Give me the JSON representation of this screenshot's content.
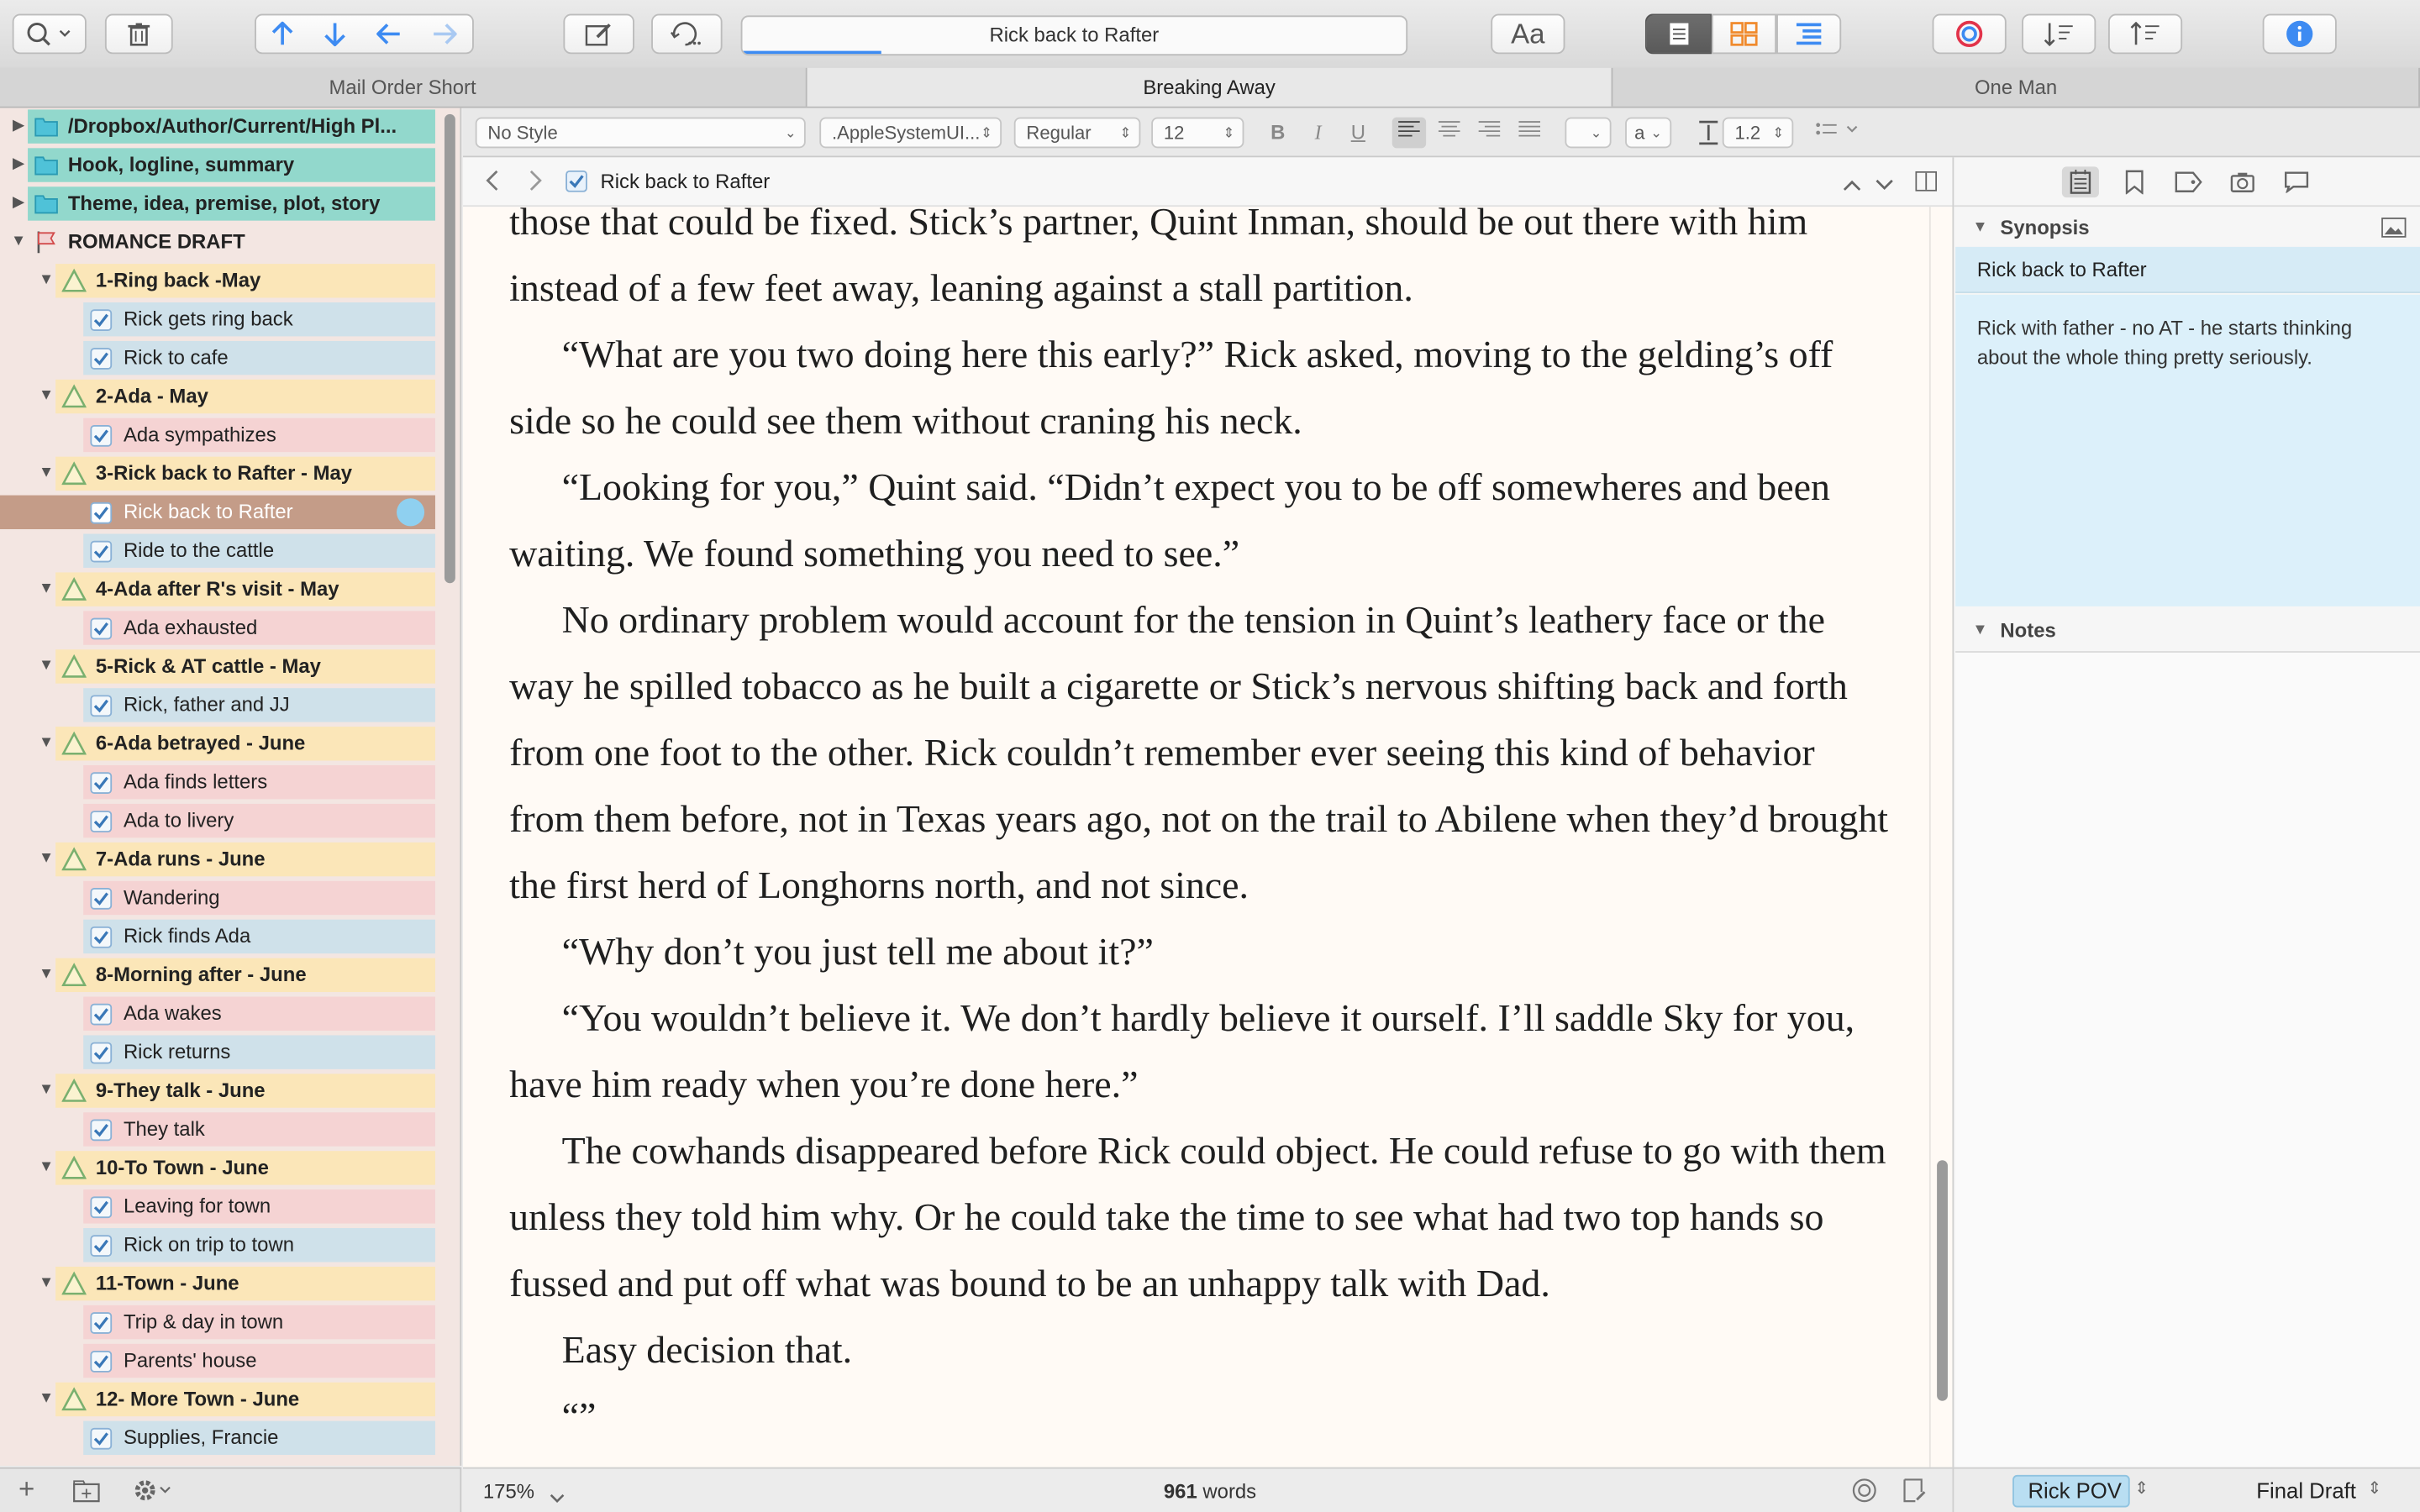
{
  "toolbar": {
    "title": "Rick back to Rafter",
    "font_button": "Aa"
  },
  "tabs": [
    "Mail Order Short",
    "Breaking Away",
    "One Man"
  ],
  "binder": {
    "items": [
      {
        "label": "/Dropbox/Author/Current/High Pl...",
        "level": 0,
        "icon": "folder-icon",
        "color": "#92d8cc"
      },
      {
        "label": "Hook, logline, summary",
        "level": 0,
        "icon": "folder-icon",
        "color": "#92d8cc"
      },
      {
        "label": "Theme, idea, premise, plot, story",
        "level": 0,
        "icon": "folder-icon",
        "color": "#92d8cc"
      },
      {
        "label": "ROMANCE DRAFT",
        "level": 0,
        "icon": "flag-icon",
        "color": ""
      },
      {
        "label": "1-Ring back -May",
        "level": 1,
        "icon": "chapter-icon",
        "color": "#fbe6b8"
      },
      {
        "label": "Rick gets ring back",
        "level": 2,
        "icon": "checkbox-icon",
        "color": "#cfe1ea"
      },
      {
        "label": "Rick to cafe",
        "level": 2,
        "icon": "checkbox-icon",
        "color": "#cfe1ea"
      },
      {
        "label": "2-Ada - May",
        "level": 1,
        "icon": "chapter-icon",
        "color": "#fbe6b8"
      },
      {
        "label": "Ada sympathizes",
        "level": 2,
        "icon": "checkbox-icon",
        "color": "#f5d3d3"
      },
      {
        "label": "3-Rick back to Rafter - May",
        "level": 1,
        "icon": "chapter-icon",
        "color": "#fbe6b8"
      },
      {
        "label": "Rick back to Rafter",
        "level": 2,
        "icon": "checkbox-icon",
        "color": "#c49c88",
        "selected": true
      },
      {
        "label": "Ride to the cattle",
        "level": 2,
        "icon": "checkbox-icon",
        "color": "#cfe1ea"
      },
      {
        "label": "4-Ada after R's visit - May",
        "level": 1,
        "icon": "chapter-icon",
        "color": "#fbe6b8"
      },
      {
        "label": "Ada exhausted",
        "level": 2,
        "icon": "checkbox-icon",
        "color": "#f5d3d3"
      },
      {
        "label": "5-Rick & AT cattle - May",
        "level": 1,
        "icon": "chapter-icon",
        "color": "#fbe6b8"
      },
      {
        "label": "Rick, father and JJ",
        "level": 2,
        "icon": "checkbox-icon",
        "color": "#cfe1ea"
      },
      {
        "label": "6-Ada betrayed - June",
        "level": 1,
        "icon": "chapter-icon",
        "color": "#fbe6b8"
      },
      {
        "label": "Ada finds letters",
        "level": 2,
        "icon": "checkbox-icon",
        "color": "#f5d3d3"
      },
      {
        "label": "Ada to livery",
        "level": 2,
        "icon": "checkbox-icon",
        "color": "#f5d3d3"
      },
      {
        "label": "7-Ada runs - June",
        "level": 1,
        "icon": "chapter-icon",
        "color": "#fbe6b8"
      },
      {
        "label": "Wandering",
        "level": 2,
        "icon": "checkbox-icon",
        "color": "#f5d3d3"
      },
      {
        "label": "Rick finds Ada",
        "level": 2,
        "icon": "checkbox-icon",
        "color": "#cfe1ea"
      },
      {
        "label": "8-Morning after - June",
        "level": 1,
        "icon": "chapter-icon",
        "color": "#fbe6b8"
      },
      {
        "label": "Ada wakes",
        "level": 2,
        "icon": "checkbox-icon",
        "color": "#f5d3d3"
      },
      {
        "label": "Rick returns",
        "level": 2,
        "icon": "checkbox-icon",
        "color": "#cfe1ea"
      },
      {
        "label": "9-They talk - June",
        "level": 1,
        "icon": "chapter-icon",
        "color": "#fbe6b8"
      },
      {
        "label": "They talk",
        "level": 2,
        "icon": "checkbox-icon",
        "color": "#f5d3d3"
      },
      {
        "label": "10-To Town - June",
        "level": 1,
        "icon": "chapter-icon",
        "color": "#fbe6b8"
      },
      {
        "label": "Leaving for town",
        "level": 2,
        "icon": "checkbox-icon",
        "color": "#f5d3d3"
      },
      {
        "label": "Rick on trip to town",
        "level": 2,
        "icon": "checkbox-icon",
        "color": "#cfe1ea"
      },
      {
        "label": "11-Town - June",
        "level": 1,
        "icon": "chapter-icon",
        "color": "#fbe6b8"
      },
      {
        "label": "Trip & day in town",
        "level": 2,
        "icon": "checkbox-icon",
        "color": "#f5d3d3"
      },
      {
        "label": "Parents' house",
        "level": 2,
        "icon": "checkbox-icon",
        "color": "#f5d3d3"
      },
      {
        "label": "12- More Town - June",
        "level": 1,
        "icon": "chapter-icon",
        "color": "#fbe6b8"
      },
      {
        "label": "Supplies, Francie",
        "level": 2,
        "icon": "checkbox-icon",
        "color": "#cfe1ea"
      }
    ]
  },
  "format": {
    "style": "No Style",
    "font": ".AppleSystemUI...",
    "weight": "Regular",
    "size": "12",
    "bold": "B",
    "italic": "I",
    "underline": "U",
    "highlight_letter": "a",
    "line_spacing": "1.2"
  },
  "header": {
    "title": "Rick back to Rafter"
  },
  "editor": {
    "paragraphs": [
      {
        "indent": false,
        "text": "those that could be fixed. Stick’s partner, Quint Inman, should be out there with him instead of a few feet away, leaning against a stall partition."
      },
      {
        "indent": true,
        "text": "“What are you two doing here this early?” Rick asked, moving to the gelding’s off side so he could see them without craning his neck."
      },
      {
        "indent": true,
        "text": "“Looking for you,” Quint said. “Didn’t expect you to be off somewheres and been waiting. We found something you need to see.”"
      },
      {
        "indent": true,
        "text": "No ordinary problem would account for the tension in Quint’s leathery face or the way he spilled tobacco as he built a cigarette or Stick’s nervous shifting back and forth from one foot to the other. Rick couldn’t remember ever seeing this kind of behavior from them before, not in Texas years ago, not on the trail to Abilene when they’d brought the first herd of Longhorns north, and not since."
      },
      {
        "indent": true,
        "text": "“Why don’t you just tell me about it?”"
      },
      {
        "indent": true,
        "text": "“You wouldn’t believe it. We don’t hardly believe it ourself. I’ll saddle Sky for you, have him ready when you’re done here.”"
      },
      {
        "indent": true,
        "text": "The cowhands disappeared before Rick could object. He could refuse to go with them unless they told him why. Or he could take the time to see what had two top hands so fussed and put off what was bound to be an unhappy talk with Dad."
      },
      {
        "indent": true,
        "text": "Easy decision that."
      },
      {
        "indent": true,
        "text": "“”"
      }
    ]
  },
  "footer": {
    "zoom": "175%",
    "word_count": "961",
    "words_label": "words"
  },
  "inspector": {
    "synopsis_label": "Synopsis",
    "synopsis_title": "Rick back to Rafter",
    "synopsis_text": "Rick with father - no AT - he starts thinking about the whole thing pretty seriously.",
    "notes_label": "Notes",
    "label_value": "Rick POV",
    "status_value": "Final Draft"
  }
}
